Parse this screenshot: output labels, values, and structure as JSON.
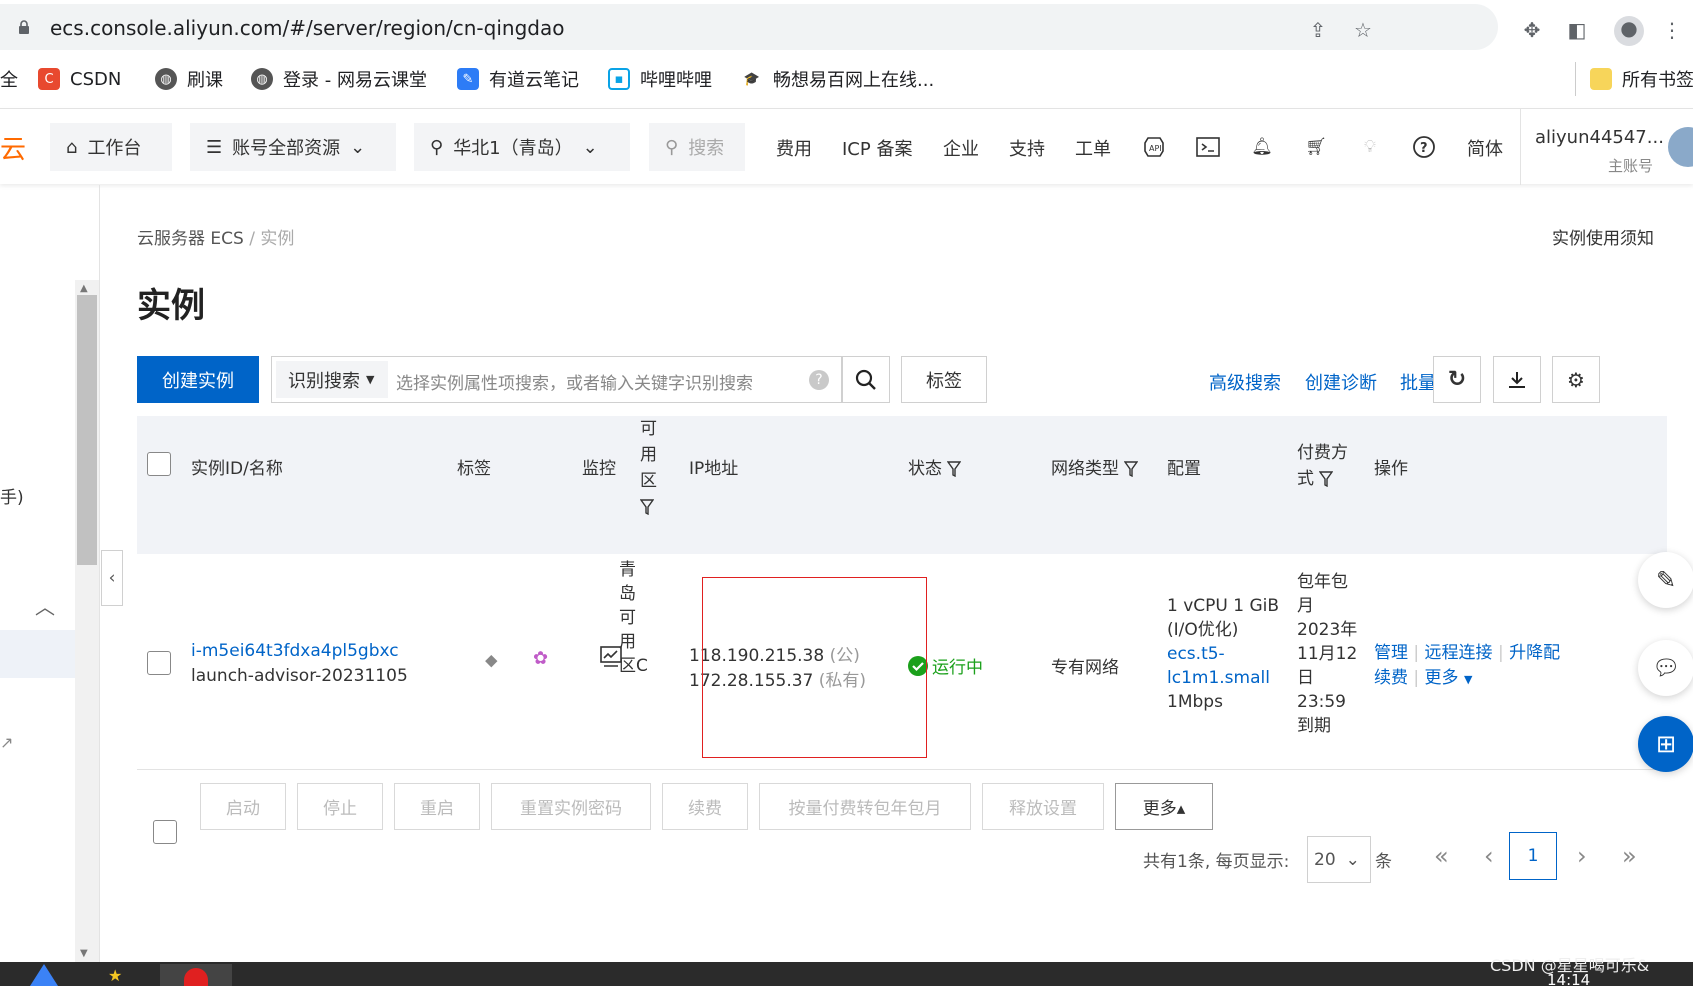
{
  "browser": {
    "url": "ecs.console.aliyun.com/#/server/region/cn-qingdao",
    "bookmarks": [
      "全",
      "CSDN",
      "刷课",
      "登录 - 网易云课堂",
      "有道云笔记",
      "哔哩哔哩",
      "畅想易百网上在线...",
      "所有书签"
    ]
  },
  "topbar": {
    "logo": "云",
    "workbench": "工作台",
    "resources": "账号全部资源",
    "region": "华北1（青岛）",
    "search_placeholder": "搜索",
    "links": [
      "费用",
      "ICP 备案",
      "企业",
      "支持",
      "工单"
    ],
    "language": "简体",
    "account_name": "aliyun44547...",
    "account_type": "主账号"
  },
  "sidebar": {
    "partial_text": "手)"
  },
  "main": {
    "breadcrumb_parent": "云服务器 ECS",
    "breadcrumb_sep": "/",
    "breadcrumb_current": "实例",
    "notice_link": "实例使用须知",
    "title": "实例",
    "create_button": "创建实例",
    "search_type": "识别搜索",
    "search_placeholder": "选择实例属性项搜索，或者输入关键字识别搜索",
    "search_help": "?",
    "tag_button": "标签",
    "advanced_search": "高级搜索",
    "create_diagnosis": "创建诊断",
    "batch_operation": "批量操作"
  },
  "table": {
    "headers": {
      "instance": "实例ID/名称",
      "tags": "标签",
      "monitor": "监控",
      "zone": [
        "可",
        "用",
        "区"
      ],
      "ip": "IP地址",
      "status": "状态",
      "network": "网络类型",
      "config": "配置",
      "billing": [
        "付费方",
        "式"
      ],
      "actions": "操作"
    },
    "rows": [
      {
        "instance_id": "i-m5ei64t3fdxa4pl5gbxc",
        "instance_name": "launch-advisor-20231105",
        "zone": [
          "青",
          "岛",
          "可",
          "用",
          "区C"
        ],
        "ip_public": "118.190.215.38",
        "ip_public_tag": "(公)",
        "ip_private": "172.28.155.37",
        "ip_private_tag": "(私有)",
        "status": "运行中",
        "network": "专有网络",
        "config": [
          "1 vCPU 1 GiB",
          "(I/O优化)",
          "ecs.t5-",
          "lc1m1.small",
          "1Mbps"
        ],
        "billing": [
          "包年包",
          "月",
          "2023年",
          "11月12",
          "日",
          "23:59",
          "到期"
        ],
        "actions": [
          "管理",
          "远程连接",
          "升降配",
          "续费",
          "更多"
        ]
      }
    ]
  },
  "batch_buttons": [
    "启动",
    "停止",
    "重启",
    "重置实例密码",
    "续费",
    "按量付费转包年包月",
    "释放设置",
    "更多▴"
  ],
  "pagination": {
    "summary": "共有1条, 每页显示:",
    "page_size": "20",
    "unit": "条",
    "first": "«",
    "prev": "‹",
    "current": "1",
    "next": "›",
    "last": "»"
  },
  "watermark": "CSDN @星星喝可乐&",
  "clock": "14:14",
  "colors": {
    "primary": "#0064c8",
    "running": "#1ba01b",
    "highlight": "#e02020"
  }
}
